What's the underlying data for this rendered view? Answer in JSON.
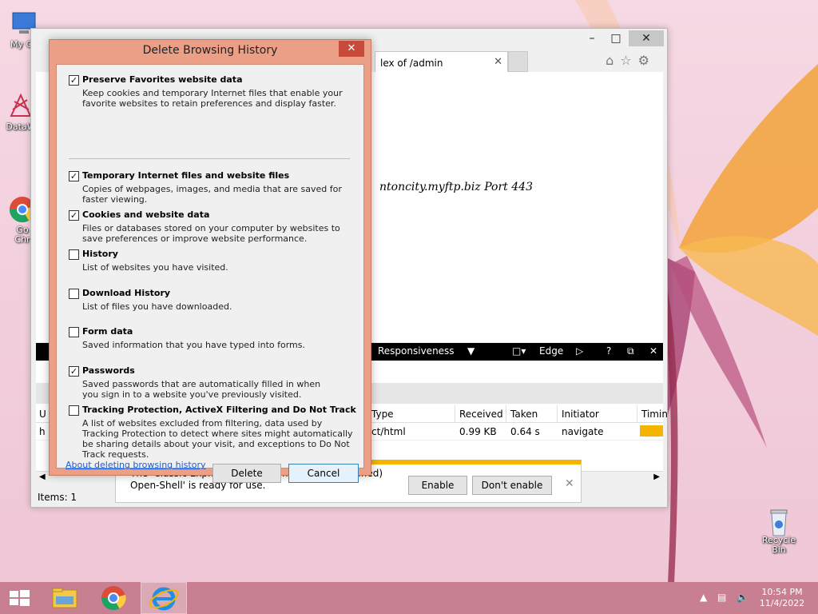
{
  "desktop": {
    "icons": [
      {
        "label": "My Co"
      },
      {
        "label": "DataW"
      },
      {
        "label": "Go\nChr"
      },
      {
        "label": "Recycle Bin"
      }
    ]
  },
  "ie": {
    "tab_title": "lex of /admin",
    "content_text": "ntoncity.myftp.biz Port 443",
    "devtools": {
      "responsiveness": "Responsiveness",
      "edge": "Edge",
      "help": "?",
      "columns": [
        "Type",
        "Received",
        "Taken",
        "Initiator",
        "Timin"
      ],
      "row": {
        "type": "ct/html",
        "received": "0.99 KB",
        "taken": "0.64 s",
        "initiator": "navigate"
      },
      "left_col_header": "U",
      "left_col_row": "h"
    },
    "status": "Items: 1",
    "notification": {
      "line1": "The 'Classic Explorer bar' add-on from '(Not verified)",
      "line2": "Open-Shell' is ready for use.",
      "enable": "Enable",
      "dont_enable": "Don't enable"
    }
  },
  "dialog": {
    "title": "Delete Browsing History",
    "options": [
      {
        "label": "Preserve Favorites website data",
        "checked": true,
        "desc": "Keep cookies and temporary Internet files that enable your favorite websites to retain preferences and display faster."
      },
      {
        "label": "Temporary Internet files and website files",
        "checked": true,
        "desc": "Copies of webpages, images, and media that are saved for faster viewing."
      },
      {
        "label": "Cookies and website data",
        "checked": true,
        "desc": "Files or databases stored on your computer by websites to save preferences or improve website performance."
      },
      {
        "label": "History",
        "checked": false,
        "desc": "List of websites you have visited."
      },
      {
        "label": "Download History",
        "checked": false,
        "desc": "List of files you have downloaded."
      },
      {
        "label": "Form data",
        "checked": false,
        "desc": "Saved information that you have typed into forms."
      },
      {
        "label": "Passwords",
        "checked": true,
        "desc": "Saved passwords that are automatically filled in when you sign in to a website you've previously visited."
      },
      {
        "label": "Tracking Protection, ActiveX Filtering and Do Not Track",
        "checked": false,
        "desc": "A list of websites excluded from filtering, data used by Tracking Protection to detect where sites might automatically be sharing details about your visit, and exceptions to Do Not Track requests."
      }
    ],
    "about_link": "About deleting browsing history",
    "delete": "Delete",
    "cancel": "Cancel"
  },
  "taskbar": {
    "time": "10:54 PM",
    "date": "11/4/2022"
  },
  "colors": {
    "dialog_frame": "#eb9f86",
    "close_red": "#c84a3a",
    "taskbar": "#c87f92",
    "accent_yellow": "#f4b400"
  }
}
